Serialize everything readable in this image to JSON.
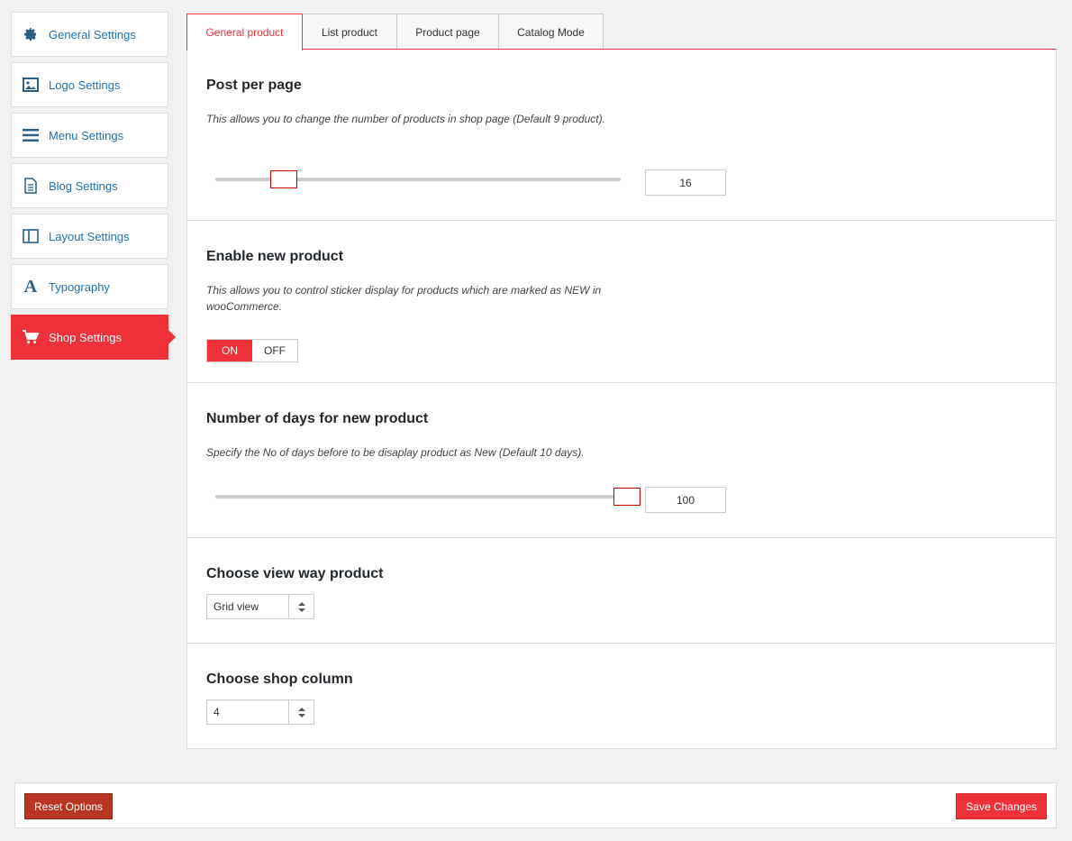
{
  "sidebar": {
    "items": [
      {
        "label": "General Settings",
        "icon": "gear-icon"
      },
      {
        "label": "Logo Settings",
        "icon": "image-icon"
      },
      {
        "label": "Menu Settings",
        "icon": "menu-icon"
      },
      {
        "label": "Blog Settings",
        "icon": "document-icon"
      },
      {
        "label": "Layout Settings",
        "icon": "layout-icon"
      },
      {
        "label": "Typography",
        "icon": "typography-icon"
      },
      {
        "label": "Shop Settings",
        "icon": "cart-icon",
        "active": true
      }
    ]
  },
  "tabs": [
    {
      "label": "General product",
      "active": true
    },
    {
      "label": "List product"
    },
    {
      "label": "Product page"
    },
    {
      "label": "Catalog Mode"
    }
  ],
  "sections": {
    "post_per_page": {
      "title": "Post per page",
      "desc": "This allows you to change the number of products in shop page (Default 9 product).",
      "value": "16"
    },
    "enable_new": {
      "title": "Enable new product",
      "desc": "This allows you to control sticker display for products which are marked as NEW in wooCommerce.",
      "on_label": "ON",
      "off_label": "OFF",
      "state": "on"
    },
    "days_new": {
      "title": "Number of days for new product",
      "desc": "Specify the No of days before to be disaplay product as New (Default 10 days).",
      "value": "100"
    },
    "view_way": {
      "title": "Choose view way product",
      "selected": "Grid view"
    },
    "shop_column": {
      "title": "Choose shop column",
      "selected": "4"
    }
  },
  "footer": {
    "reset_label": "Reset Options",
    "save_label": "Save Changes"
  },
  "colors": {
    "accent": "#ef3139",
    "reset": "#b83524",
    "link": "#2271b1"
  }
}
